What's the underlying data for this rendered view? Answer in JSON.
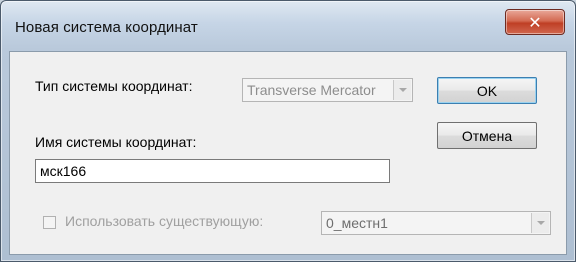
{
  "window": {
    "title": "Новая система координат",
    "close_glyph": "✕"
  },
  "form": {
    "type_label": "Тип системы координат:",
    "type_value": "Transverse Mercator",
    "name_label": "Имя системы координат:",
    "name_value": "мск166",
    "use_existing_label": "Использовать существующую:",
    "use_existing_checked": false,
    "existing_value": "0_местн1"
  },
  "buttons": {
    "ok_label": "OK",
    "cancel_label": "Отмена"
  },
  "icons": {
    "close": "close-icon",
    "dropdown": "chevron-down-icon"
  },
  "colors": {
    "close_button": "#c9472c",
    "title_bar": "#c6d5e6",
    "client_bg": "#f0f0f0"
  }
}
